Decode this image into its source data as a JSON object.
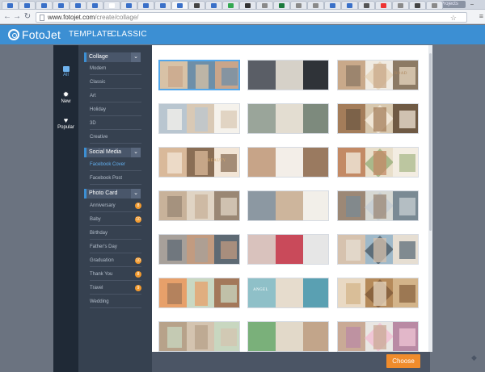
{
  "browser": {
    "url_host": "www.fotojet.com",
    "url_path": "/create/collage/",
    "window_label": "Projects"
  },
  "app": {
    "logo": "FotoJet",
    "tabs": [
      {
        "label": "TEMPLATE"
      },
      {
        "label": "CLASSIC"
      }
    ]
  },
  "rail": [
    {
      "label": "All"
    },
    {
      "label": "New"
    },
    {
      "label": "Popular"
    }
  ],
  "categories": {
    "collage": {
      "title": "Collage",
      "items": [
        "Modern",
        "Classic",
        "Art",
        "Holiday",
        "3D",
        "Creative"
      ]
    },
    "social": {
      "title": "Social Media",
      "items": [
        "Facebook Cover",
        "Facebook Post"
      ]
    },
    "photo_card": {
      "title": "Photo Card",
      "items": [
        {
          "label": "Anniversary",
          "badge": "8"
        },
        {
          "label": "Baby",
          "badge": "10"
        },
        {
          "label": "Birthday",
          "badge": ""
        },
        {
          "label": "Father's Day",
          "badge": ""
        },
        {
          "label": "Graduation",
          "badge": "10"
        },
        {
          "label": "Thank You",
          "badge": "8"
        },
        {
          "label": "Travel",
          "badge": "9"
        },
        {
          "label": "Wedding",
          "badge": ""
        }
      ]
    }
  },
  "template_captions": {
    "road": "ROAD",
    "beauty": "BEAUTY",
    "angel": "ANGEL"
  },
  "footer": {
    "choose": "Choose"
  }
}
